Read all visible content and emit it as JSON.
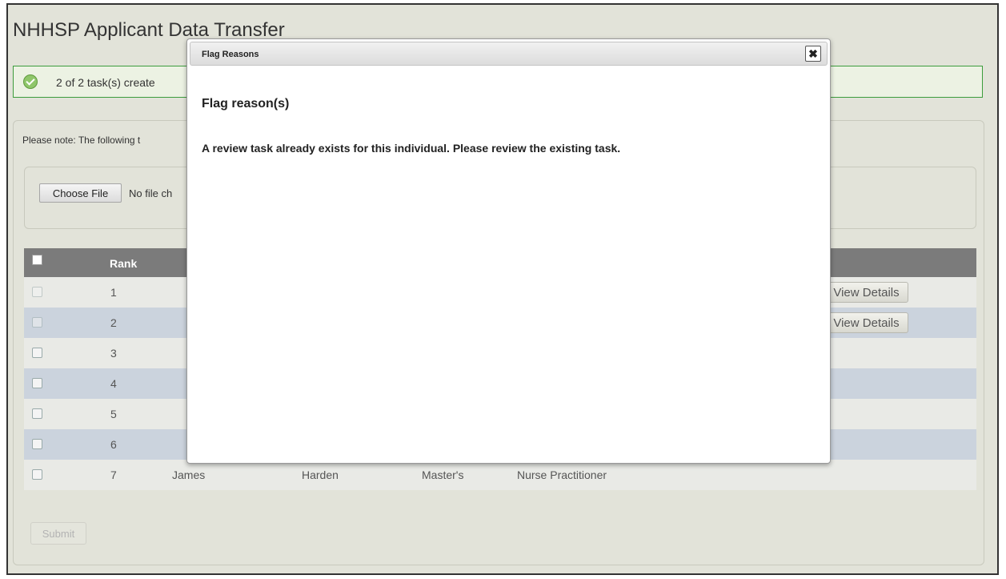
{
  "page": {
    "title": "NHHSP Applicant Data Transfer"
  },
  "alert": {
    "message": "2 of 2 task(s) create",
    "icon": "check-circle-icon"
  },
  "note": {
    "text": "Please note: The following t"
  },
  "file_input": {
    "button_label": "Choose File",
    "status": "No file ch"
  },
  "table": {
    "header": {
      "rank": "Rank"
    },
    "rows": [
      {
        "rank": "1",
        "first": "",
        "last": "",
        "degree": "",
        "profession": "",
        "action": "View Details",
        "checkbox_disabled": true
      },
      {
        "rank": "2",
        "first": "",
        "last": "",
        "degree": "",
        "profession": "",
        "action": "View Details",
        "checkbox_disabled": true
      },
      {
        "rank": "3",
        "first": "",
        "last": "",
        "degree": "",
        "profession": "",
        "action": "",
        "checkbox_disabled": false
      },
      {
        "rank": "4",
        "first": "",
        "last": "",
        "degree": "",
        "profession": "",
        "action": "",
        "checkbox_disabled": false
      },
      {
        "rank": "5",
        "first": "",
        "last": "",
        "degree": "",
        "profession": "",
        "action": "",
        "checkbox_disabled": false
      },
      {
        "rank": "6",
        "first": "",
        "last": "",
        "degree": "",
        "profession": "",
        "action": "",
        "checkbox_disabled": false
      },
      {
        "rank": "7",
        "first": "James",
        "last": "Harden",
        "degree": "Master's",
        "profession": "Nurse Practitioner",
        "action": "",
        "checkbox_disabled": false
      }
    ]
  },
  "submit": {
    "label": "Submit"
  },
  "modal": {
    "title": "Flag Reasons",
    "heading": "Flag reason(s)",
    "text": "A review task already exists for this individual. Please review the existing task.",
    "close_icon": "close-icon"
  },
  "colors": {
    "page_bg": "#e2e3d9",
    "table_header": "#7b7b7b",
    "row_odd": "#e9eae6",
    "row_even": "#cbd3dd",
    "alert_border": "#3c9c3c"
  }
}
